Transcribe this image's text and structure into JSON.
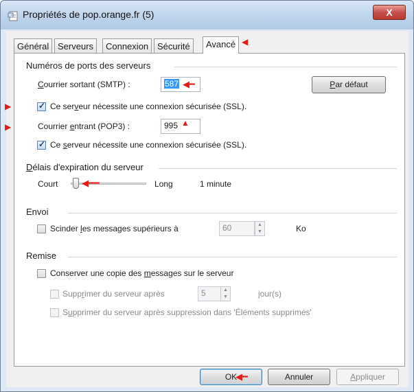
{
  "window": {
    "title": "Propriétés de pop.orange.fr (5)",
    "close_glyph": "X"
  },
  "tabs": [
    {
      "label": "Général"
    },
    {
      "label": "Serveurs"
    },
    {
      "label": "Connexion"
    },
    {
      "label": "Sécurité"
    },
    {
      "label": "Avancé",
      "active": true
    }
  ],
  "ports": {
    "section_title": "Numéros de ports des serveurs",
    "smtp_label_pre": "C",
    "smtp_label_rest": "ourrier sortant (SMTP) :",
    "smtp_value": "587",
    "default_button_pre": "P",
    "default_button_rest": "ar défaut",
    "ssl_smtp_pre": "Ce ser",
    "ssl_smtp_u": "v",
    "ssl_smtp_post": "eur nécessite une connexion sécurisée (SSL).",
    "ssl_smtp_checked": true,
    "pop3_label_pre": "Courrier ",
    "pop3_label_u": "e",
    "pop3_label_post": "ntrant (POP3) :",
    "pop3_value": "995",
    "ssl_pop3_pre": "Ce ",
    "ssl_pop3_u": "s",
    "ssl_pop3_post": "erveur nécessite une connexion sécurisée (SSL).",
    "ssl_pop3_checked": true
  },
  "timeout": {
    "section_title_u": "D",
    "section_title_rest": "élais d'expiration du serveur",
    "short_label": "Court",
    "long_label": "Long",
    "value_text": "1 minute",
    "slider_level": 0.0
  },
  "send": {
    "section_title": "Envoi",
    "split_pre": "Scinder ",
    "split_u": "l",
    "split_post": "es messages supérieurs à",
    "split_checked": false,
    "split_value": "60",
    "unit": "Ko"
  },
  "delivery": {
    "section_title": "Remise",
    "keep_pre": "Conserver une copie des ",
    "keep_u": "m",
    "keep_post": "essages sur le serveur",
    "keep_checked": false,
    "remove_after_pre": "Supp",
    "remove_after_u": "r",
    "remove_after_post": "imer du serveur après",
    "remove_after_value": "5",
    "days_unit": "jour(s)",
    "remove_deleted_pre": "S",
    "remove_deleted_u": "u",
    "remove_deleted_post": "pprimer du serveur après suppression dans 'Éléments supprimés'"
  },
  "footer": {
    "ok_label": "OK",
    "cancel_label": "Annuler",
    "apply_pre": "",
    "apply_u": "A",
    "apply_post": "ppliquer"
  },
  "annotations": {
    "arrow_color": "#e21b1b"
  }
}
